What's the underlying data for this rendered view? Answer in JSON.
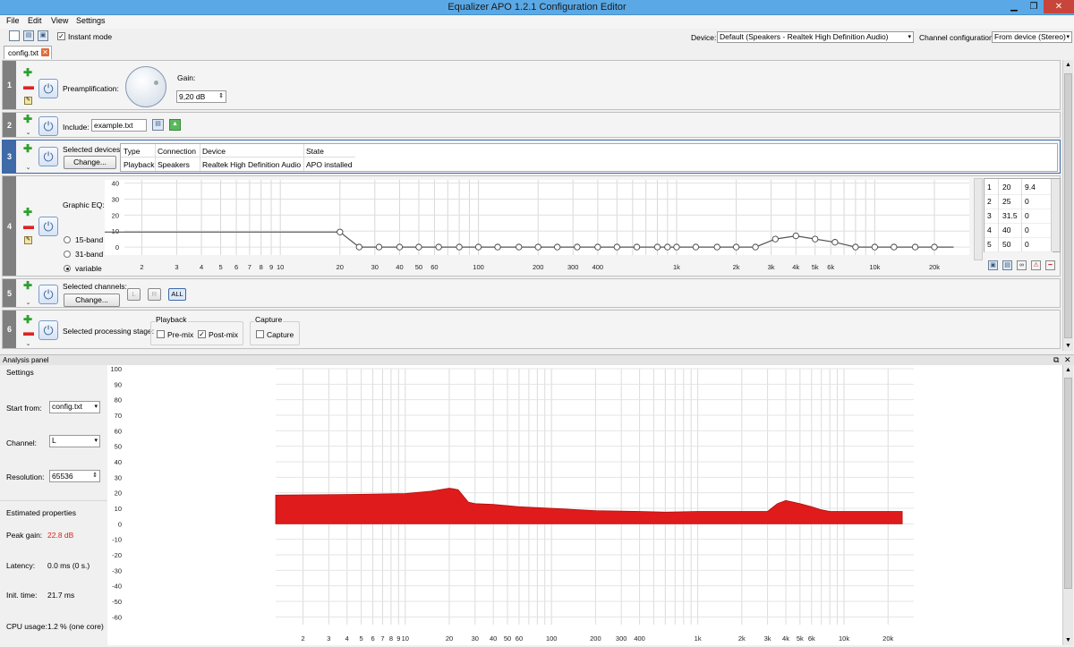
{
  "window": {
    "title": "Equalizer APO 1.2.1 Configuration Editor"
  },
  "menu": [
    "File",
    "Edit",
    "View",
    "Settings"
  ],
  "toolbar": {
    "instant_mode_label": "Instant mode",
    "device_label": "Device:",
    "device_value": "Default (Speakers - Realtek High Definition Audio)",
    "channel_config_label": "Channel configuration:",
    "channel_config_value": "From device (Stereo)"
  },
  "tab": {
    "label": "config.txt"
  },
  "filters": {
    "f1": {
      "num": "1",
      "label": "Preamplification:",
      "gain_label": "Gain:",
      "gain_value": "9,20 dB"
    },
    "f2": {
      "num": "2",
      "label": "Include:",
      "value": "example.txt"
    },
    "f3": {
      "num": "3",
      "label": "Selected devices:",
      "change": "Change...",
      "headers": [
        "Type",
        "Connection",
        "Device",
        "State"
      ],
      "row": [
        "Playback",
        "Speakers",
        "Realtek High Definition Audio",
        "APO installed"
      ]
    },
    "f4": {
      "num": "4",
      "label": "Graphic EQ:",
      "opt1": "15-band",
      "opt2": "31-band",
      "opt3": "variable",
      "y_ticks": [
        "40",
        "30",
        "20",
        "10",
        "0"
      ],
      "x_ticks": [
        "2",
        "3",
        "4",
        "5",
        "6",
        "7",
        "8",
        "9",
        "10",
        "20",
        "30",
        "40",
        "50",
        "60",
        "100",
        "200",
        "300",
        "400",
        "1k",
        "2k",
        "3k",
        "4k",
        "5k",
        "6k",
        "10k",
        "20k"
      ],
      "bands": [
        {
          "n": "1",
          "f": "20",
          "g": "9.4"
        },
        {
          "n": "2",
          "f": "25",
          "g": "0"
        },
        {
          "n": "3",
          "f": "31.5",
          "g": "0"
        },
        {
          "n": "4",
          "f": "40",
          "g": "0"
        },
        {
          "n": "5",
          "f": "50",
          "g": "0"
        }
      ]
    },
    "f5": {
      "num": "5",
      "label": "Selected channels:",
      "change": "Change...",
      "l": "L",
      "r": "R",
      "all": "ALL"
    },
    "f6": {
      "num": "6",
      "label": "Selected processing stage:",
      "playback": "Playback",
      "premix": "Pre-mix",
      "postmix": "Post-mix",
      "capture_group": "Capture",
      "capture": "Capture"
    }
  },
  "analysis": {
    "title": "Analysis panel",
    "settings_title": "Settings",
    "start_from_label": "Start from:",
    "start_from_value": "config.txt",
    "channel_label": "Channel:",
    "channel_value": "L",
    "resolution_label": "Resolution:",
    "resolution_value": "65536",
    "estimated_title": "Estimated properties",
    "peak_gain_label": "Peak gain:",
    "peak_gain_value": "22.8 dB",
    "latency_label": "Latency:",
    "latency_value": "0.0 ms (0 s.)",
    "init_time_label": "Init. time:",
    "init_time_value": "21.7 ms",
    "cpu_label": "CPU usage:",
    "cpu_value": "1.2 % (one core)",
    "y_ticks": [
      "100",
      "90",
      "80",
      "70",
      "60",
      "50",
      "40",
      "30",
      "20",
      "10",
      "0",
      "-10",
      "-20",
      "-30",
      "-40",
      "-50",
      "-60"
    ],
    "x_ticks": [
      "2",
      "3",
      "4",
      "5",
      "6",
      "7",
      "8",
      "9",
      "10",
      "20",
      "30",
      "40",
      "50",
      "60",
      "100",
      "200",
      "300",
      "400",
      "1k",
      "2k",
      "3k",
      "4k",
      "5k",
      "6k",
      "10k",
      "20k"
    ],
    "accent_color": "#e01b1b"
  },
  "chart_data": [
    {
      "type": "line",
      "xscale": "log",
      "xlim": [
        1.3,
        30000
      ],
      "ylim": [
        -5,
        42
      ],
      "x": [
        1.3,
        20,
        25,
        31.5,
        40,
        50,
        63,
        80,
        100,
        125,
        160,
        200,
        250,
        315,
        400,
        500,
        630,
        800,
        900,
        1000,
        1250,
        1600,
        2000,
        2500,
        3150,
        4000,
        5000,
        6300,
        8000,
        10000,
        12500,
        16000,
        20000,
        25000
      ],
      "y": [
        9.4,
        9.4,
        0,
        0,
        0,
        0,
        0,
        0,
        0,
        0,
        0,
        0,
        0,
        0,
        0,
        0,
        0,
        0,
        0,
        0,
        0,
        0,
        0,
        0,
        5,
        7,
        5,
        3,
        0,
        0,
        0,
        0,
        0,
        0
      ]
    },
    {
      "type": "area",
      "xscale": "log",
      "xlim": [
        1.3,
        30000
      ],
      "ylim": [
        -65,
        100
      ],
      "x": [
        1.3,
        5,
        10,
        15,
        20,
        23,
        27,
        30,
        40,
        60,
        100,
        200,
        400,
        600,
        1000,
        1500,
        2000,
        2500,
        3000,
        3500,
        4000,
        5000,
        6000,
        7000,
        8000,
        9000,
        10000,
        20000,
        25000
      ],
      "upper": [
        18.5,
        19,
        19.5,
        21,
        23,
        22,
        14,
        13,
        12.5,
        11,
        10,
        8.5,
        8,
        7.5,
        8,
        8,
        8,
        8,
        8,
        13,
        15,
        13,
        11,
        9,
        8,
        8,
        8,
        8,
        8
      ],
      "lower": [
        0,
        0,
        0,
        0,
        0,
        0,
        0,
        0,
        0,
        0,
        0,
        0,
        0,
        0,
        0,
        0,
        0,
        0,
        0,
        0,
        0,
        0,
        0,
        0,
        0,
        0,
        0,
        0,
        0
      ]
    }
  ]
}
